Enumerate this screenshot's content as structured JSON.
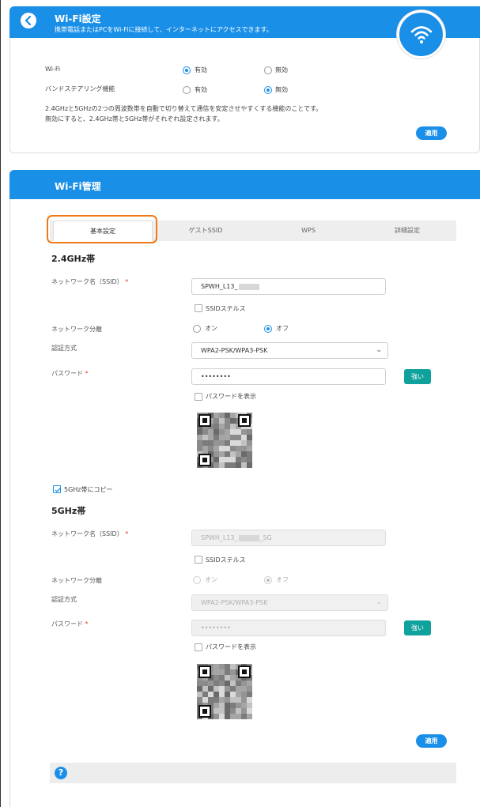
{
  "wifi_settings": {
    "title": "Wi-Fi設定",
    "subtitle": "携帯電話またはPCをWi-Fiに接続して、インターネットにアクセスできます。",
    "wifi_label": "Wi-Fi",
    "wifi_on_label": "有効",
    "wifi_off_label": "無効",
    "wifi_value": "有効",
    "band_steering_label": "バンドステアリング機能",
    "band_on_label": "有効",
    "band_off_label": "無効",
    "band_value": "無効",
    "description_line1": "2.4GHzと5GHzの2つの周波数帯を自動で切り替えて通信を安定させやすくする機能のことです。",
    "description_line2": "無効にすると、2.4GHz帯と5GHz帯がそれぞれ設定されます。",
    "apply_label": "適用"
  },
  "wifi_management": {
    "title": "Wi-Fi管理",
    "tabs": [
      {
        "label": "基本設定",
        "active": true
      },
      {
        "label": "ゲストSSID",
        "active": false
      },
      {
        "label": "WPS",
        "active": false
      },
      {
        "label": "詳細設定",
        "active": false
      }
    ],
    "band24": {
      "heading": "2.4GHz帯",
      "ssid_label": "ネットワーク名（SSID）",
      "required_mark": "*",
      "ssid_value": "SPWH_L13_",
      "stealth_label": "SSIDステルス",
      "isolation_label": "ネットワーク分離",
      "isolation_on_label": "オン",
      "isolation_off_label": "オフ",
      "isolation_value": "オフ",
      "auth_label": "認証方式",
      "auth_value": "WPA2-PSK/WPA3-PSK",
      "password_label": "パスワード",
      "password_value": "••••••••",
      "strength_label": "強い",
      "show_password_label": "パスワードを表示"
    },
    "copy_to_5g_label": "5GHz帯にコピー",
    "copy_to_5g_checked": true,
    "band5": {
      "heading": "5GHz帯",
      "ssid_label": "ネットワーク名（SSID）",
      "required_mark": "*",
      "ssid_value_prefix": "SPWH_L13_",
      "ssid_value_suffix": "_5G",
      "stealth_label": "SSIDステルス",
      "isolation_label": "ネットワーク分離",
      "isolation_on_label": "オン",
      "isolation_off_label": "オフ",
      "isolation_value": "オフ",
      "auth_label": "認証方式",
      "auth_value": "WPA2-PSK/WPA3-PSK",
      "password_label": "パスワード",
      "password_value": "••••••••",
      "strength_label": "強い",
      "show_password_label": "パスワードを表示"
    },
    "apply_label": "適用",
    "help_icon": "?"
  },
  "colors": {
    "accent": "#1a8fe8",
    "tab_highlight": "#ef7a1a",
    "strength": "#0fa19b",
    "required": "#e53935"
  }
}
